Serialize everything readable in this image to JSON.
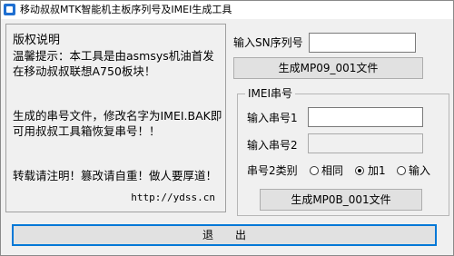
{
  "window": {
    "title": "移动叔叔MTK智能机主板序列号及IMEI生成工具"
  },
  "copyright": {
    "title": "版权说明",
    "notice": "温馨提示：本工具是由asmsys机油首发在移动叔叔联想A750板块！",
    "instructions": "生成的串号文件，修改名字为IMEI.BAK即可用叔叔工具箱恢复串号！！",
    "warning": "转载请注明！篡改请自重！做人要厚道！",
    "website": "http://ydss.cn"
  },
  "sn": {
    "label": "输入SN序列号",
    "value": "",
    "generate_label": "生成MP09_001文件"
  },
  "imei": {
    "group_title": "IMEI串号",
    "imei1_label": "输入串号1",
    "imei1_value": "",
    "imei2_label": "输入串号2",
    "imei2_value": "",
    "mode_label": "串号2类别",
    "options": [
      {
        "label": "相同",
        "checked": false
      },
      {
        "label": "加1",
        "checked": true
      },
      {
        "label": "输入",
        "checked": false
      }
    ],
    "generate_label": "生成MP0B_001文件"
  },
  "footer": {
    "exit_label": "退　　出"
  }
}
